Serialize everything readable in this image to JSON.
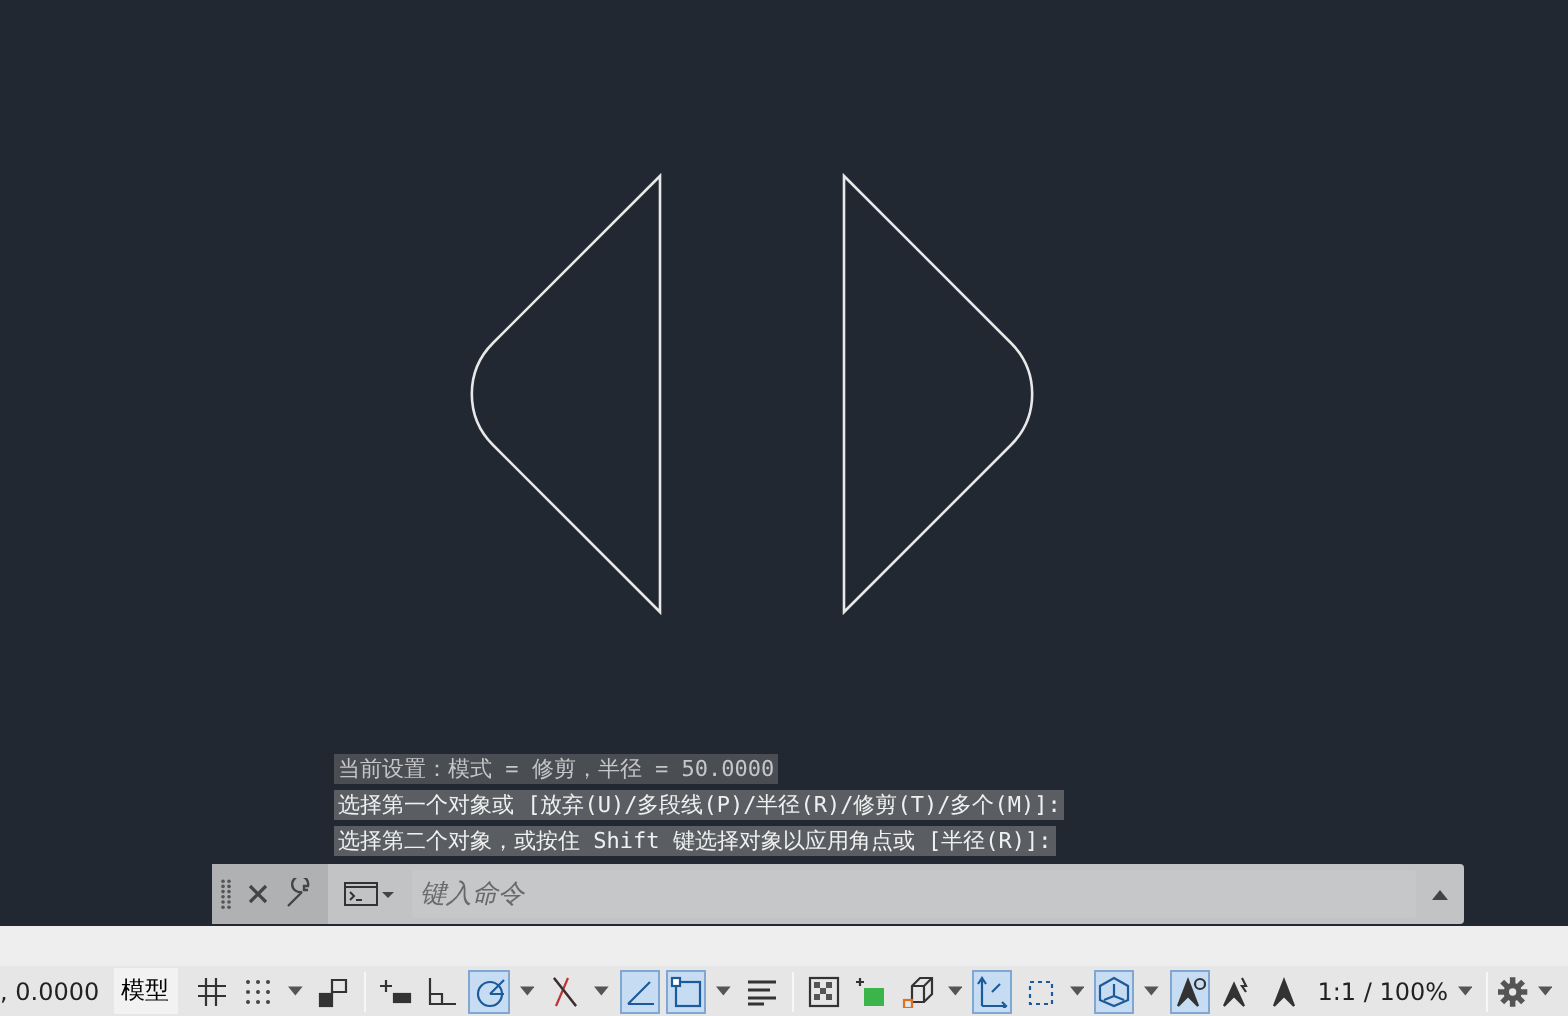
{
  "command_history": [
    "当前设置：模式 = 修剪，半径 = 50.0000",
    "选择第一个对象或 [放弃(U)/多段线(P)/半径(R)/修剪(T)/多个(M)]:",
    "选择第二个对象，或按住 Shift 键选择对象以应用角点或 [半径(R)]:"
  ],
  "command_line": {
    "placeholder": "键入命令"
  },
  "status_bar": {
    "coordinates": ", 0.0000",
    "model_tab": "模型",
    "buttons": [
      {
        "on": false,
        "menu": false
      },
      {
        "on": false,
        "menu": true
      },
      {
        "on": false,
        "menu": false
      },
      {
        "on": false,
        "menu": false
      },
      {
        "on": false,
        "menu": false
      },
      {
        "on": true,
        "menu": true
      },
      {
        "on": false,
        "menu": true
      },
      {
        "on": true,
        "menu": false
      },
      {
        "on": true,
        "menu": true
      },
      {
        "on": false,
        "menu": false
      },
      {
        "on": false,
        "menu": false
      },
      {
        "on": false,
        "menu": false
      },
      {
        "on": false,
        "menu": true
      },
      {
        "on": true,
        "menu": false
      },
      {
        "on": false,
        "menu": true
      },
      {
        "on": true,
        "menu": true
      },
      {
        "on": true,
        "menu": false
      },
      {
        "on": false,
        "menu": false
      },
      {
        "on": false,
        "menu": false
      }
    ],
    "scale": "1:1 / 100%"
  }
}
